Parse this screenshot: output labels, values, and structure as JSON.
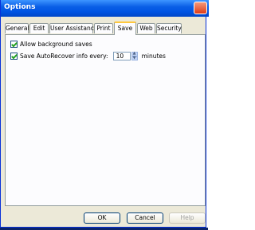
{
  "window": {
    "title": "Options"
  },
  "tabs": [
    "General",
    "Edit",
    "User Assistance",
    "Print",
    "Save",
    "Web",
    "Security"
  ],
  "active_tab": "Save",
  "options": {
    "background_saves": {
      "label": "Allow background saves",
      "checked": true
    },
    "autorecover": {
      "label": "Save AutoRecover info every:",
      "checked": true,
      "value": "10",
      "unit": "minutes"
    }
  },
  "buttons": {
    "ok": "OK",
    "cancel": "Cancel",
    "help": "Help"
  }
}
